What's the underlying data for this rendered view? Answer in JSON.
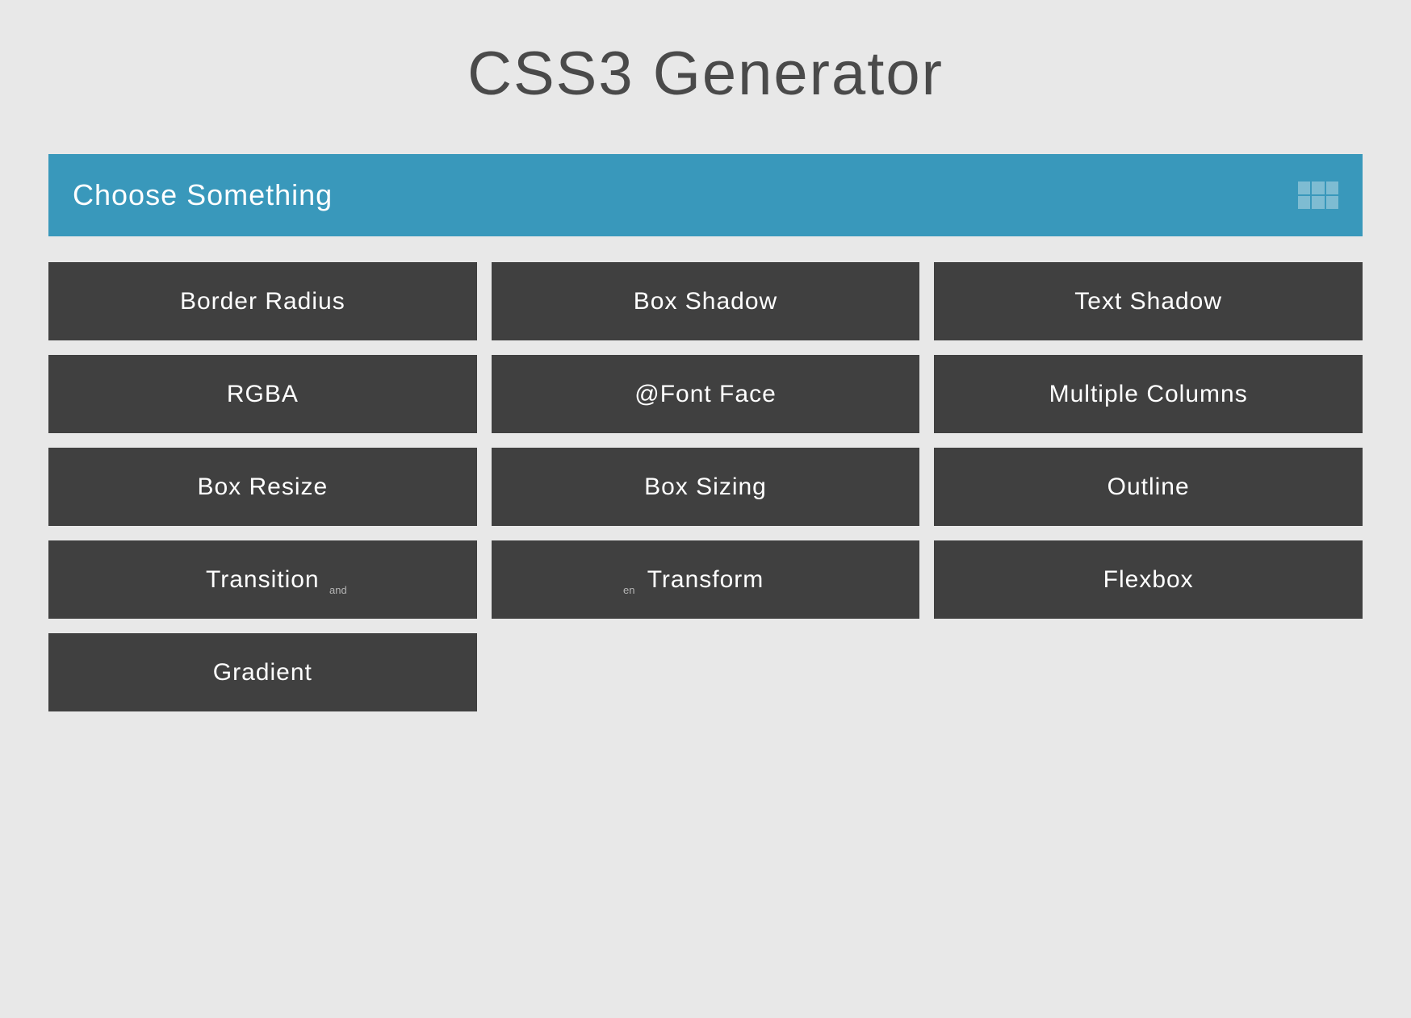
{
  "page": {
    "title": "CSS3 Generator"
  },
  "header": {
    "label": "Choose Something",
    "icon": "grid-icon"
  },
  "options": [
    {
      "label": "Border Radius",
      "slug": "border-radius"
    },
    {
      "label": "Box Shadow",
      "slug": "box-shadow"
    },
    {
      "label": "Text Shadow",
      "slug": "text-shadow"
    },
    {
      "label": "RGBA",
      "slug": "rgba"
    },
    {
      "label": "@Font Face",
      "slug": "font-face"
    },
    {
      "label": "Multiple Columns",
      "slug": "multiple-columns"
    },
    {
      "label": "Box Resize",
      "slug": "box-resize"
    },
    {
      "label": "Box Sizing",
      "slug": "box-sizing"
    },
    {
      "label": "Outline",
      "slug": "outline"
    },
    {
      "label": "Transition",
      "slug": "transition"
    },
    {
      "label": "Transform",
      "slug": "transform"
    },
    {
      "label": "Flexbox",
      "slug": "flexbox"
    },
    {
      "label": "Gradient",
      "slug": "gradient"
    }
  ],
  "ghost": {
    "frag1": "and",
    "frag2": "en"
  },
  "colors": {
    "background": "#e8e8e8",
    "headerBar": "#3998bb",
    "tile": "#404040",
    "titleText": "#4a4a4a",
    "white": "#ffffff"
  }
}
